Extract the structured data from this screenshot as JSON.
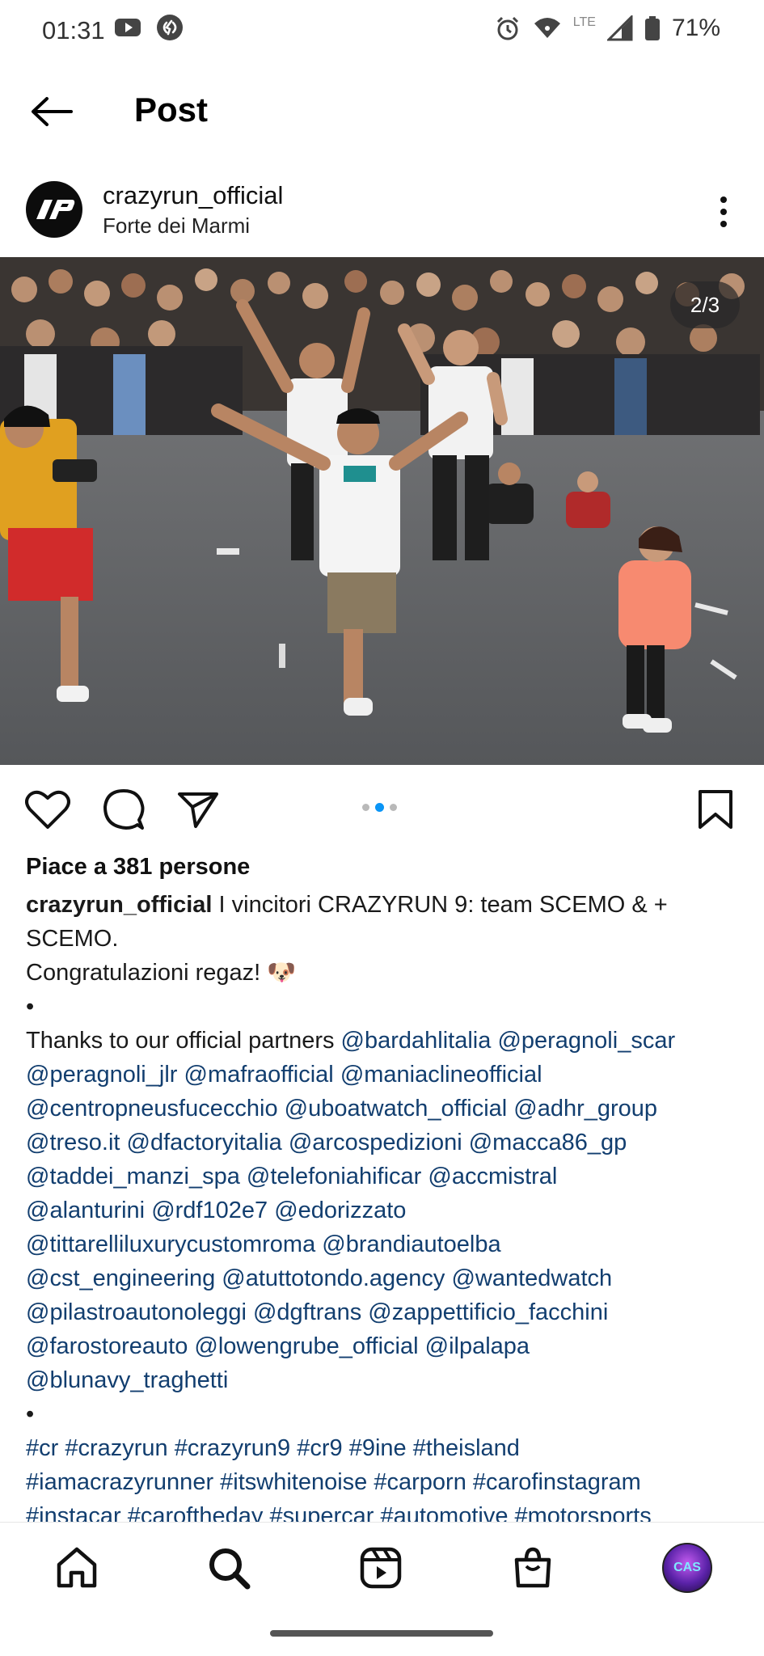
{
  "status_bar": {
    "time": "01:31",
    "battery": "71%",
    "network": "LTE",
    "icons": [
      "youtube-icon",
      "shazam-icon",
      "alarm-icon",
      "wifi-icon",
      "signal-icon",
      "battery-icon"
    ]
  },
  "header": {
    "title": "Post",
    "back_icon": "arrow-left-icon"
  },
  "post": {
    "username": "crazyrun_official",
    "location": "Forte dei Marmi",
    "photo_counter": "2/3",
    "carousel": {
      "count": 3,
      "active": 2
    },
    "likes": "Piace a 381 persone",
    "caption": {
      "user": "crazyrun_official",
      "line1_text": " I vincitori CRAZYRUN 9: team SCEMO & +",
      "line2_text": "SCEMO.",
      "line3_text": "Congratulazioni regaz! 🐶",
      "bullet": "•",
      "partners_intro": "Thanks to our official partners ",
      "mention_lines": [
        [
          "@bardahlitalia",
          "@peragnoli_scar"
        ],
        [
          "@peragnoli_jlr",
          "@mafraofficial",
          "@maniaclineofficial"
        ],
        [
          "@centropneusfucecchio",
          "@uboatwatch_official",
          "@adhr_group"
        ],
        [
          "@treso.it",
          "@dfactoryitalia",
          "@arcospedizioni",
          "@macca86_gp"
        ],
        [
          "@taddei_manzi_spa",
          "@telefoniahificar",
          "@accmistral"
        ],
        [
          "@alanturini",
          "@rdf102e7",
          "@edorizzato"
        ],
        [
          "@tittarelliluxurycustomroma",
          "@brandiautoelba"
        ],
        [
          "@cst_engineering",
          "@atuttotondo.agency",
          "@wantedwatch"
        ],
        [
          "@pilastroautonoleggi",
          "@dgftrans",
          "@zappettificio_facchini"
        ],
        [
          "@farostoreauto",
          "@lowengrube_official",
          "@ilpalapa"
        ],
        [
          "@blunavy_traghetti"
        ]
      ],
      "hashtag_lines": [
        "#cr #crazyrun #crazyrun9 #cr9 #9ine #theisland",
        "#iamacrazyrunner #itswhitenoise #carporn #carofinstagram",
        "#instacar #caroftheday #supercar #automotive #motorsports"
      ]
    }
  },
  "bottom_nav": {
    "items": [
      "home-icon",
      "search-icon",
      "reels-icon",
      "shop-icon",
      "profile-avatar"
    ],
    "profile_label": "CAS"
  }
}
